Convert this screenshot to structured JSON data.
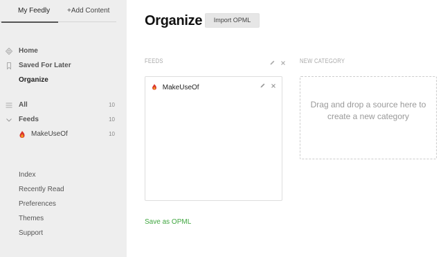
{
  "sidebar": {
    "tabs": [
      {
        "label": "My Feedly"
      },
      {
        "label": "+Add Content"
      }
    ],
    "nav": {
      "home": "Home",
      "saved": "Saved For Later",
      "organize": "Organize"
    },
    "categories": {
      "all": {
        "label": "All",
        "count": "10"
      },
      "feeds": {
        "label": "Feeds",
        "count": "10"
      },
      "makeuseof": {
        "label": "MakeUseOf",
        "count": "10"
      }
    },
    "links": [
      "Index",
      "Recently Read",
      "Preferences",
      "Themes",
      "Support"
    ]
  },
  "main": {
    "title": "Organize",
    "import_button": "Import OPML",
    "feeds_label": "FEEDS",
    "new_category_label": "NEW CATEGORY",
    "feed_items": [
      {
        "label": "MakeUseOf"
      }
    ],
    "drop_text": "Drag and drop a source here to create a new category",
    "save_opml": "Save as OPML"
  },
  "colors": {
    "sidebar_bg": "#eeeeee",
    "link_green": "#3fa63f",
    "feed_icon_red": "#d9342b",
    "feed_icon_orange": "#f29b21"
  },
  "icons": {
    "home": "home-icon",
    "saved": "bookmark-icon",
    "all": "list-icon",
    "feeds": "chevron-down-icon",
    "makeuseof": "makeuseof-logo-icon",
    "edit": "pencil-icon",
    "close": "close-icon"
  }
}
